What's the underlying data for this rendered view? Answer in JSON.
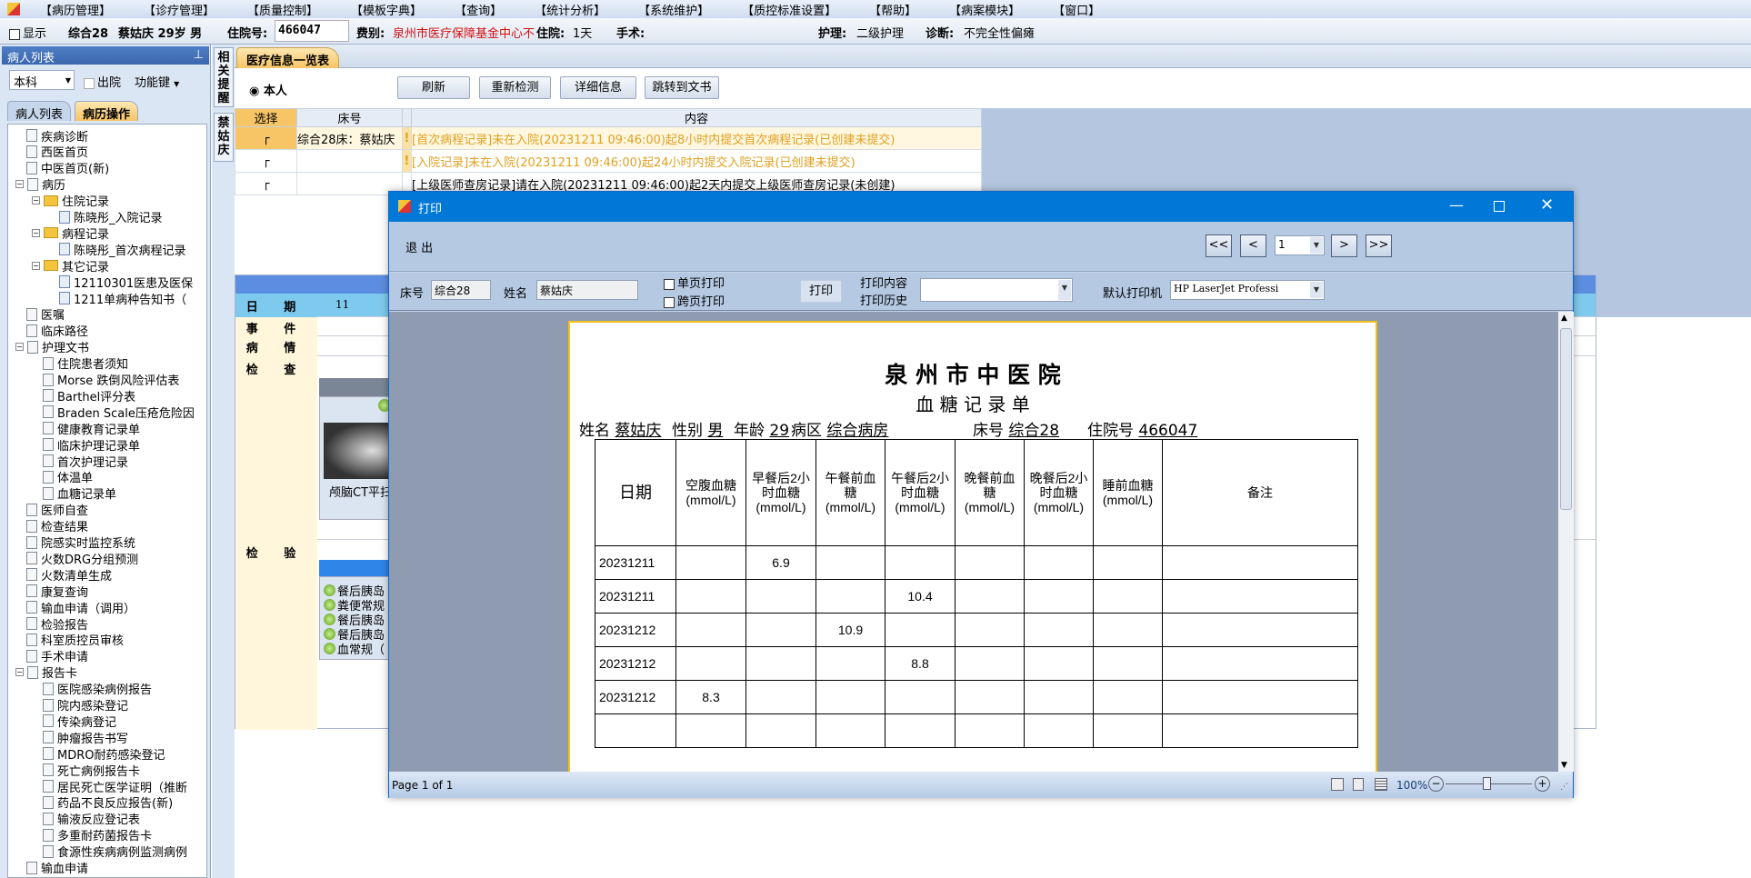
{
  "menu": [
    "【病历管理】",
    "【诊疗管理】",
    "【质量控制】",
    "【模板字典】",
    "【查询】",
    "【统计分析】",
    "【系统维护】",
    "【质控标准设置】",
    "【帮助】",
    "【病案模块】",
    "【窗口】"
  ],
  "info": {
    "show_label": "显示",
    "bed": "综合28",
    "patient": "蔡姑庆 29岁 男",
    "inpatient_no_label": "住院号:",
    "inpatient_no": "466047",
    "fee_label": "费别:",
    "fee": "泉州市医疗保障基金中心不",
    "stay_label": "住院:",
    "stay": "1天",
    "surgery_label": "手术:",
    "nursing_label": "护理:",
    "nursing": "二级护理",
    "diagnosis_label": "诊断:",
    "diagnosis": "不完全性偏瘫"
  },
  "sidebar": {
    "title": "病人列表",
    "dept": "本科",
    "discharged_label": "出院",
    "function_key": "功能键",
    "tabs": [
      "病人列表",
      "病历操作"
    ],
    "tree": [
      {
        "label": "疾病诊断",
        "level": 0
      },
      {
        "label": "西医首页",
        "level": 0
      },
      {
        "label": "中医首页(新)",
        "level": 0
      },
      {
        "label": "病历",
        "level": 0,
        "exp": true
      },
      {
        "label": "住院记录",
        "level": 1,
        "folder": true,
        "exp": true
      },
      {
        "label": "陈晓彤_入院记录",
        "level": 2
      },
      {
        "label": "病程记录",
        "level": 1,
        "folder": true,
        "exp": true
      },
      {
        "label": "陈晓彤_首次病程记录",
        "level": 2
      },
      {
        "label": "其它记录",
        "level": 1,
        "folder": true,
        "exp": true
      },
      {
        "label": "12110301医患及医保",
        "level": 2
      },
      {
        "label": "1211单病种告知书（",
        "level": 2
      },
      {
        "label": "医嘱",
        "level": 0
      },
      {
        "label": "临床路径",
        "level": 0
      },
      {
        "label": "护理文书",
        "level": 0,
        "exp": true
      },
      {
        "label": "住院患者须知",
        "level": 1
      },
      {
        "label": "Morse 跌倒风险评估表",
        "level": 1
      },
      {
        "label": "Barthel评分表",
        "level": 1
      },
      {
        "label": "Braden Scale压疮危险因",
        "level": 1
      },
      {
        "label": "健康教育记录单",
        "level": 1
      },
      {
        "label": "临床护理记录单",
        "level": 1
      },
      {
        "label": "首次护理记录",
        "level": 1
      },
      {
        "label": "体温单",
        "level": 1
      },
      {
        "label": "血糖记录单",
        "level": 1
      },
      {
        "label": "医师自查",
        "level": 0
      },
      {
        "label": "检查结果",
        "level": 0
      },
      {
        "label": "院感实时监控系统",
        "level": 0
      },
      {
        "label": "火数DRG分组预测",
        "level": 0
      },
      {
        "label": "火数清单生成",
        "level": 0
      },
      {
        "label": "康复查询",
        "level": 0
      },
      {
        "label": "输血申请（调用）",
        "level": 0
      },
      {
        "label": "检验报告",
        "level": 0
      },
      {
        "label": "科室质控员审核",
        "level": 0
      },
      {
        "label": "手术申请",
        "level": 0
      },
      {
        "label": "报告卡",
        "level": 0,
        "exp": true
      },
      {
        "label": "医院感染病例报告",
        "level": 1
      },
      {
        "label": "院内感染登记",
        "level": 1
      },
      {
        "label": "传染病登记",
        "level": 1
      },
      {
        "label": "肿瘤报告书写",
        "level": 1
      },
      {
        "label": "MDRO耐药感染登记",
        "level": 1
      },
      {
        "label": "死亡病例报告卡",
        "level": 1
      },
      {
        "label": "居民死亡医学证明（推断",
        "level": 1
      },
      {
        "label": "药品不良反应报告(新)",
        "level": 1
      },
      {
        "label": "输液反应登记表",
        "level": 1
      },
      {
        "label": "多重耐药菌报告卡",
        "level": 1
      },
      {
        "label": "食源性疾病病例监测病例",
        "level": 1
      },
      {
        "label": "输血申请",
        "level": 0
      }
    ]
  },
  "vtabs": [
    "相关提醒",
    "禁姑庆"
  ],
  "main": {
    "tab": "医疗信息一览表",
    "radio": "本人",
    "buttons": [
      "刷新",
      "重新检测",
      "详细信息",
      "跳转到文书"
    ],
    "columns": [
      "选择",
      "床号",
      "内容"
    ],
    "rows": [
      {
        "bed": "综合28床：蔡姑庆",
        "flag": "!",
        "content": "[首次病程记录]未在入院(20231211  09:46:00)起8小时内提交首次病程记录(已创建未提交)",
        "warn": true
      },
      {
        "bed": "",
        "flag": "!",
        "content": "[入院记录]未在入院(20231211  09:46:00)起24小时内提交入院记录(已创建未提交)",
        "warn": true
      },
      {
        "bed": "",
        "flag": "",
        "content": "[上级医师查房记录]请在入院(20231211  09:46:00)起2天内提交上级医师查房记录(未创建)",
        "warn": false
      }
    ],
    "lower": {
      "labels": [
        "日 期",
        "事 件",
        "病 情",
        "检 查",
        "检 验"
      ],
      "date_value": "11",
      "exam_caption": "颅脑CT平扫",
      "lab_items": [
        "餐后胰岛",
        "粪便常规",
        "餐后胰岛",
        "餐后胰岛",
        "血常规（"
      ]
    }
  },
  "dialog": {
    "title": "打印",
    "exit": "退 出",
    "nav": [
      "<<",
      "<",
      "1",
      ">",
      ">>"
    ],
    "bed_label": "床号",
    "bed": "综合28",
    "name_label": "姓名",
    "name": "蔡姑庆",
    "single_page": "单页打印",
    "cross_page": "跨页打印",
    "print": "打印",
    "print_content": "打印内容",
    "print_history": "打印历史",
    "printer_label": "默认打印机",
    "printer": "HP LaserJet Professi",
    "status": "Page 1 of 1",
    "zoom": "100%",
    "paper": {
      "hospital": "泉 州 市 中 医 院",
      "form": "血 糖 记 录 单",
      "fields": [
        {
          "label": "姓名",
          "value": "蔡姑庆"
        },
        {
          "label": "性别",
          "value": "男"
        },
        {
          "label": "年龄",
          "value": "29"
        },
        {
          "label": "病区",
          "value": "综合病房"
        },
        {
          "label": "床号",
          "value": "综合28"
        },
        {
          "label": "住院号",
          "value": "466047"
        }
      ],
      "columns": [
        "日期",
        "空腹血糖\n(mmol/L)",
        "早餐后2小时血糖\n(mmol/L)",
        "午餐前血糖\n(mmol/L)",
        "午餐后2小时血糖\n(mmol/L)",
        "晚餐前血糖\n(mmol/L)",
        "晚餐后2小时血糖\n(mmol/L)",
        "睡前血糖\n(mmol/L)",
        "备注"
      ],
      "rows": [
        [
          "20231211",
          "",
          "6.9",
          "",
          "",
          "",
          "",
          "",
          ""
        ],
        [
          "20231211",
          "",
          "",
          "",
          "10.4",
          "",
          "",
          "",
          ""
        ],
        [
          "20231212",
          "",
          "",
          "10.9",
          "",
          "",
          "",
          "",
          ""
        ],
        [
          "20231212",
          "",
          "",
          "",
          "8.8",
          "",
          "",
          "",
          ""
        ],
        [
          "20231212",
          "8.3",
          "",
          "",
          "",
          "",
          "",
          "",
          ""
        ],
        [
          "",
          "",
          "",
          "",
          "",
          "",
          "",
          "",
          ""
        ]
      ]
    }
  },
  "colors": {
    "titlebar": "#0078d7",
    "warning": "#e0a020",
    "fee": "#d01010",
    "tab_active": "#f7c565"
  }
}
